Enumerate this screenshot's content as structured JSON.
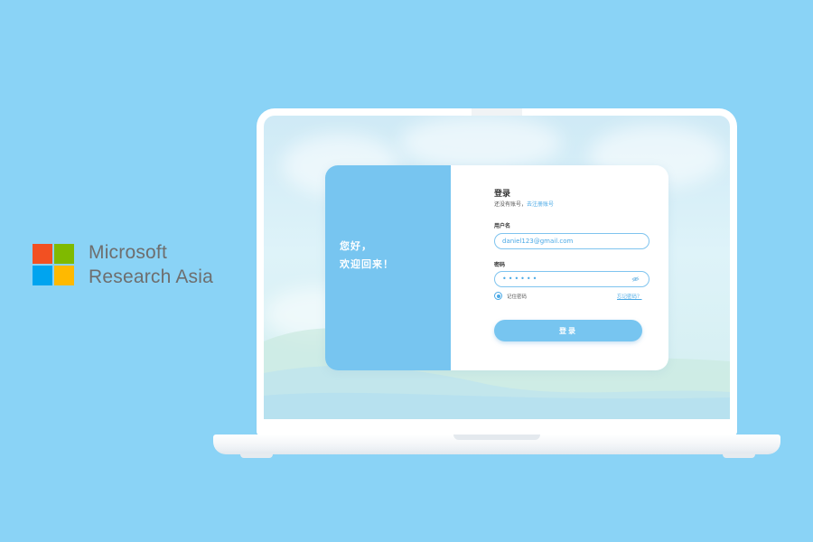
{
  "brand": {
    "line1": "Microsoft",
    "line2": "Research Asia",
    "logo_colors": [
      "#f25022",
      "#7fba00",
      "#00a4ef",
      "#ffb900"
    ]
  },
  "login_card": {
    "greeting_line1": "您好，",
    "greeting_line2": "欢迎回来！",
    "title": "登录",
    "subtitle_prefix": "还没有账号，",
    "register_link": "去注册账号",
    "username_label": "用户名",
    "username_value": "daniel123@gmail.com",
    "password_label": "密码",
    "password_value": "••••••",
    "password_toggle_icon": "eye-icon",
    "remember_label": "记住密码",
    "forgot_link": "忘记密码？",
    "login_button": "登录"
  },
  "colors": {
    "background": "#8ad3f6",
    "accent": "#77c5f0",
    "link": "#4aa9e6"
  }
}
